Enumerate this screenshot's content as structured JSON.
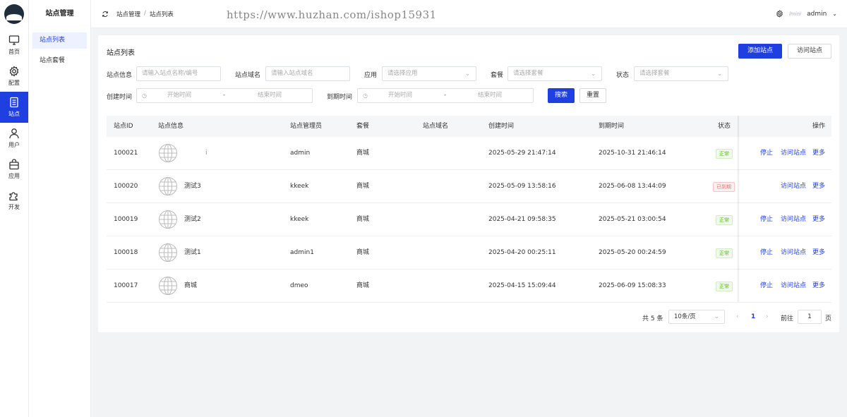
{
  "rail": {
    "items": [
      {
        "label": "首页",
        "icon": "monitor-icon"
      },
      {
        "label": "配置",
        "icon": "gear-icon"
      },
      {
        "label": "站点",
        "icon": "document-icon",
        "active": true
      },
      {
        "label": "用户",
        "icon": "user-icon"
      },
      {
        "label": "应用",
        "icon": "bag-icon"
      },
      {
        "label": "开发",
        "icon": "puzzle-icon"
      }
    ]
  },
  "submenu": {
    "title": "站点管理",
    "items": [
      "站点列表",
      "站点套餐"
    ]
  },
  "topbar": {
    "breadcrumb": [
      "站点管理",
      "站点列表"
    ],
    "watermark": "https://www.huzhan.com/ishop15931",
    "user_tag": "lmini",
    "username": "admin"
  },
  "page": {
    "title": "站点列表",
    "add_button": "添加站点",
    "visit_button": "访问站点"
  },
  "filters": {
    "site_info_label": "站点信息",
    "site_info_placeholder": "请输入站点名称/编号",
    "domain_label": "站点域名",
    "domain_placeholder": "请输入站点域名",
    "app_label": "应用",
    "app_placeholder": "请选择应用",
    "package_label": "套餐",
    "package_placeholder": "请选择套餐",
    "status_label": "状态",
    "status_placeholder": "请选择套餐",
    "create_time_label": "创建时间",
    "expire_time_label": "到期时间",
    "start_placeholder": "开始时间",
    "end_placeholder": "结束时间",
    "range_sep": "-",
    "search_button": "搜索",
    "reset_button": "重置"
  },
  "table": {
    "headers": [
      "站点ID",
      "站点信息",
      "站点管理员",
      "套餐",
      "站点域名",
      "创建时间",
      "到期时间",
      "状态",
      "操作"
    ],
    "rows": [
      {
        "id": "100021",
        "name": "i",
        "admin": "admin",
        "package": "商城",
        "domain": "",
        "created": "2025-05-29 21:47:14",
        "expires": "2025-10-31 21:46:14",
        "status": "正常",
        "status_type": "ok",
        "stop": "停止",
        "visit": "访问站点",
        "more": "更多"
      },
      {
        "id": "100020",
        "name": "测试3",
        "admin": "kkeek",
        "package": "商城",
        "domain": "",
        "created": "2025-05-09 13:58:16",
        "expires": "2025-06-08 13:44:09",
        "status": "已到期",
        "status_type": "bad",
        "stop": "",
        "visit": "访问站点",
        "more": "更多"
      },
      {
        "id": "100019",
        "name": "测试2",
        "admin": "kkeek",
        "package": "商城",
        "domain": "",
        "created": "2025-04-21 09:58:35",
        "expires": "2025-05-21 03:00:54",
        "status": "正常",
        "status_type": "ok",
        "stop": "停止",
        "visit": "访问站点",
        "more": "更多"
      },
      {
        "id": "100018",
        "name": "测试1",
        "admin": "admin1",
        "package": "商城",
        "domain": "",
        "created": "2025-04-20 00:25:11",
        "expires": "2025-05-20 00:24:59",
        "status": "正常",
        "status_type": "ok",
        "stop": "停止",
        "visit": "访问站点",
        "more": "更多"
      },
      {
        "id": "100017",
        "name": "商城",
        "admin": "dmeo",
        "package": "商城",
        "domain": "",
        "created": "2025-04-15 15:09:44",
        "expires": "2025-06-09 15:08:33",
        "status": "正常",
        "status_type": "ok",
        "stop": "停止",
        "visit": "访问站点",
        "more": "更多"
      }
    ]
  },
  "pagination": {
    "total": "共 5 条",
    "page_size": "10条/页",
    "current": "1",
    "goto_label": "前往",
    "goto_value": "1",
    "page_suffix": "页"
  },
  "colors": {
    "accent": "#1f3fe0",
    "ok": "#52c41a",
    "expired": "#f56c6c"
  }
}
